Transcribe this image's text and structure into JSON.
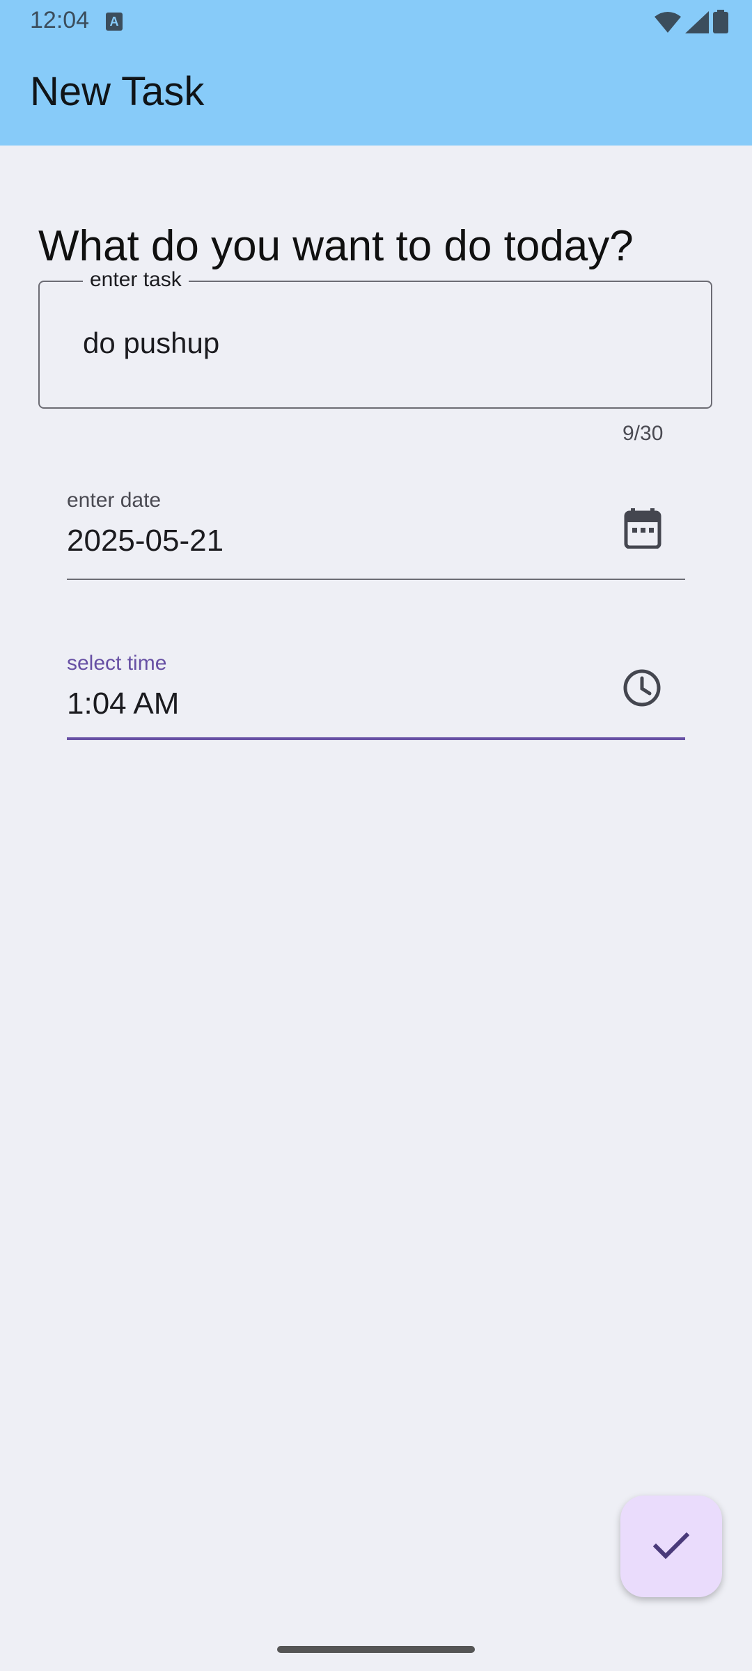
{
  "status_bar": {
    "time": "12:04",
    "notification_glyph": "A",
    "icons": [
      "wifi-icon",
      "cell-signal-icon",
      "battery-icon"
    ]
  },
  "app_bar": {
    "title": "New Task"
  },
  "main": {
    "heading": "What do you want to do today?",
    "task_field": {
      "label": "enter task",
      "value": "do pushup",
      "counter": "9/30"
    },
    "date_field": {
      "label": "enter date",
      "value": "2025-05-21",
      "icon": "calendar-icon"
    },
    "time_field": {
      "label": "select time",
      "value": "1:04 AM",
      "icon": "clock-icon",
      "focused": true
    }
  },
  "fab": {
    "icon": "check-icon"
  },
  "colors": {
    "app_bar": "#87cbf9",
    "background": "#eeeff5",
    "accent": "#6750a4",
    "fab": "#eadcfc"
  }
}
